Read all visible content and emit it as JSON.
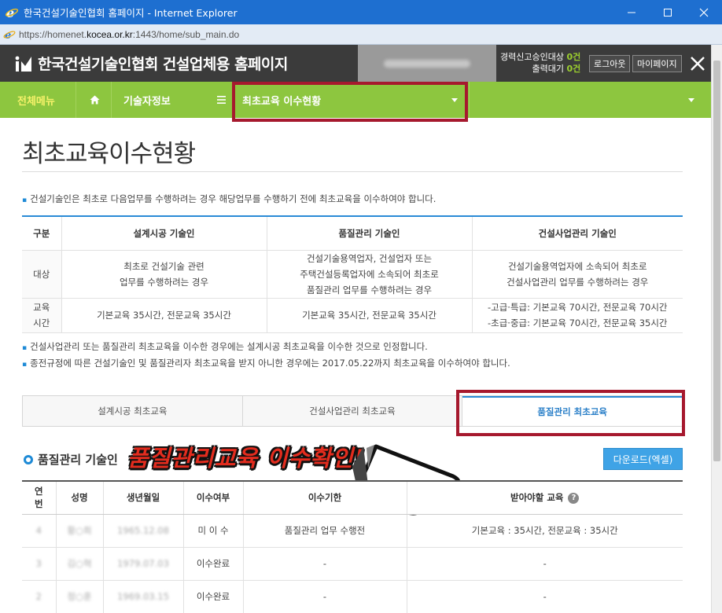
{
  "browser": {
    "window_title": "한국건설기술인협회 홈페이지 - Internet Explorer",
    "url_prefix": "https://homenet.",
    "url_domain": "kocea.or.kr",
    "url_suffix": ":1443/home/sub_main.do"
  },
  "header": {
    "site_title": "한국건설기술인협회 건설업체용 홈페이지",
    "status_line1_label": "경력신고승인대상",
    "status_line1_count": "0건",
    "status_line2_label": "출력대기",
    "status_line2_count": "0건",
    "logout_label": "로그아웃",
    "mypage_label": "마이페이지"
  },
  "nav": {
    "all_menu": "전체메뉴",
    "tech_info": "기술자정보",
    "current": "최초교육 이수현황"
  },
  "page": {
    "title": "최초교육이수현황",
    "note_top": "건설기술인은 최초로 다음업무를 수행하려는 경우 해당업무를 수행하기 전에 최초교육을 이수하여야 합니다.",
    "note_bottom_1": "건설사업관리 또는 품질관리 최초교육을 이수한 경우에는 설계시공 최초교육을 이수한 것으로 인정합니다.",
    "note_bottom_2": "종전규정에 따른 건설기술인 및 품질관리자 최초교육을 받지 아니한 경우에는 2017.05.22까지 최초교육을 이수하여야 합니다."
  },
  "info_table": {
    "headers": [
      "구분",
      "설계시공 기술인",
      "품질관리 기술인",
      "건설사업관리 기술인"
    ],
    "target_label": "대상",
    "target_design_1": "최초로 건설기술 관련",
    "target_design_2": "업무를 수행하려는 경우",
    "target_quality_1": "건설기술용역업자, 건설업자 또는",
    "target_quality_2": "주택건설등록업자에 소속되어 최초로",
    "target_quality_3": "품질관리 업무를 수행하려는 경우",
    "target_cm_1": "건설기술용역업자에 소속되어 최초로",
    "target_cm_2": "건설사업관리 업무를 수행하려는 경우",
    "time_label_1": "교육",
    "time_label_2": "시간",
    "time_design": "기본교육 35시간, 전문교육 35시간",
    "time_quality": "기본교육 35시간, 전문교육 35시간",
    "time_cm_1": "-고급·특급: 기본교육 70시간, 전문교육 70시간",
    "time_cm_2": "-초급·중급: 기본교육 70시간, 전문교육 35시간"
  },
  "tabs": [
    "설계시공 최초교육",
    "건설사업관리 최초교육",
    "품질관리 최초교육"
  ],
  "section": {
    "title": "품질관리 기술인",
    "overlay": "품질관리교육 이수확인!",
    "download": "다운로드(엑셀)"
  },
  "list_table": {
    "headers": [
      "연번",
      "성명",
      "생년월일",
      "이수여부",
      "이수기한",
      "받아야할 교육"
    ],
    "rows": [
      {
        "no": "4",
        "name": "황○희",
        "birth": "1965.12.08",
        "status": "미 이 수",
        "deadline": "품질관리 업무 수행전",
        "required": "기본교육 : 35시간, 전문교육 : 35시간"
      },
      {
        "no": "3",
        "name": "김○혁",
        "birth": "1979.07.03",
        "status": "이수완료",
        "deadline": "-",
        "required": "-"
      },
      {
        "no": "2",
        "name": "정○훈",
        "birth": "1969.03.15",
        "status": "이수완료",
        "deadline": "-",
        "required": "-"
      }
    ]
  }
}
